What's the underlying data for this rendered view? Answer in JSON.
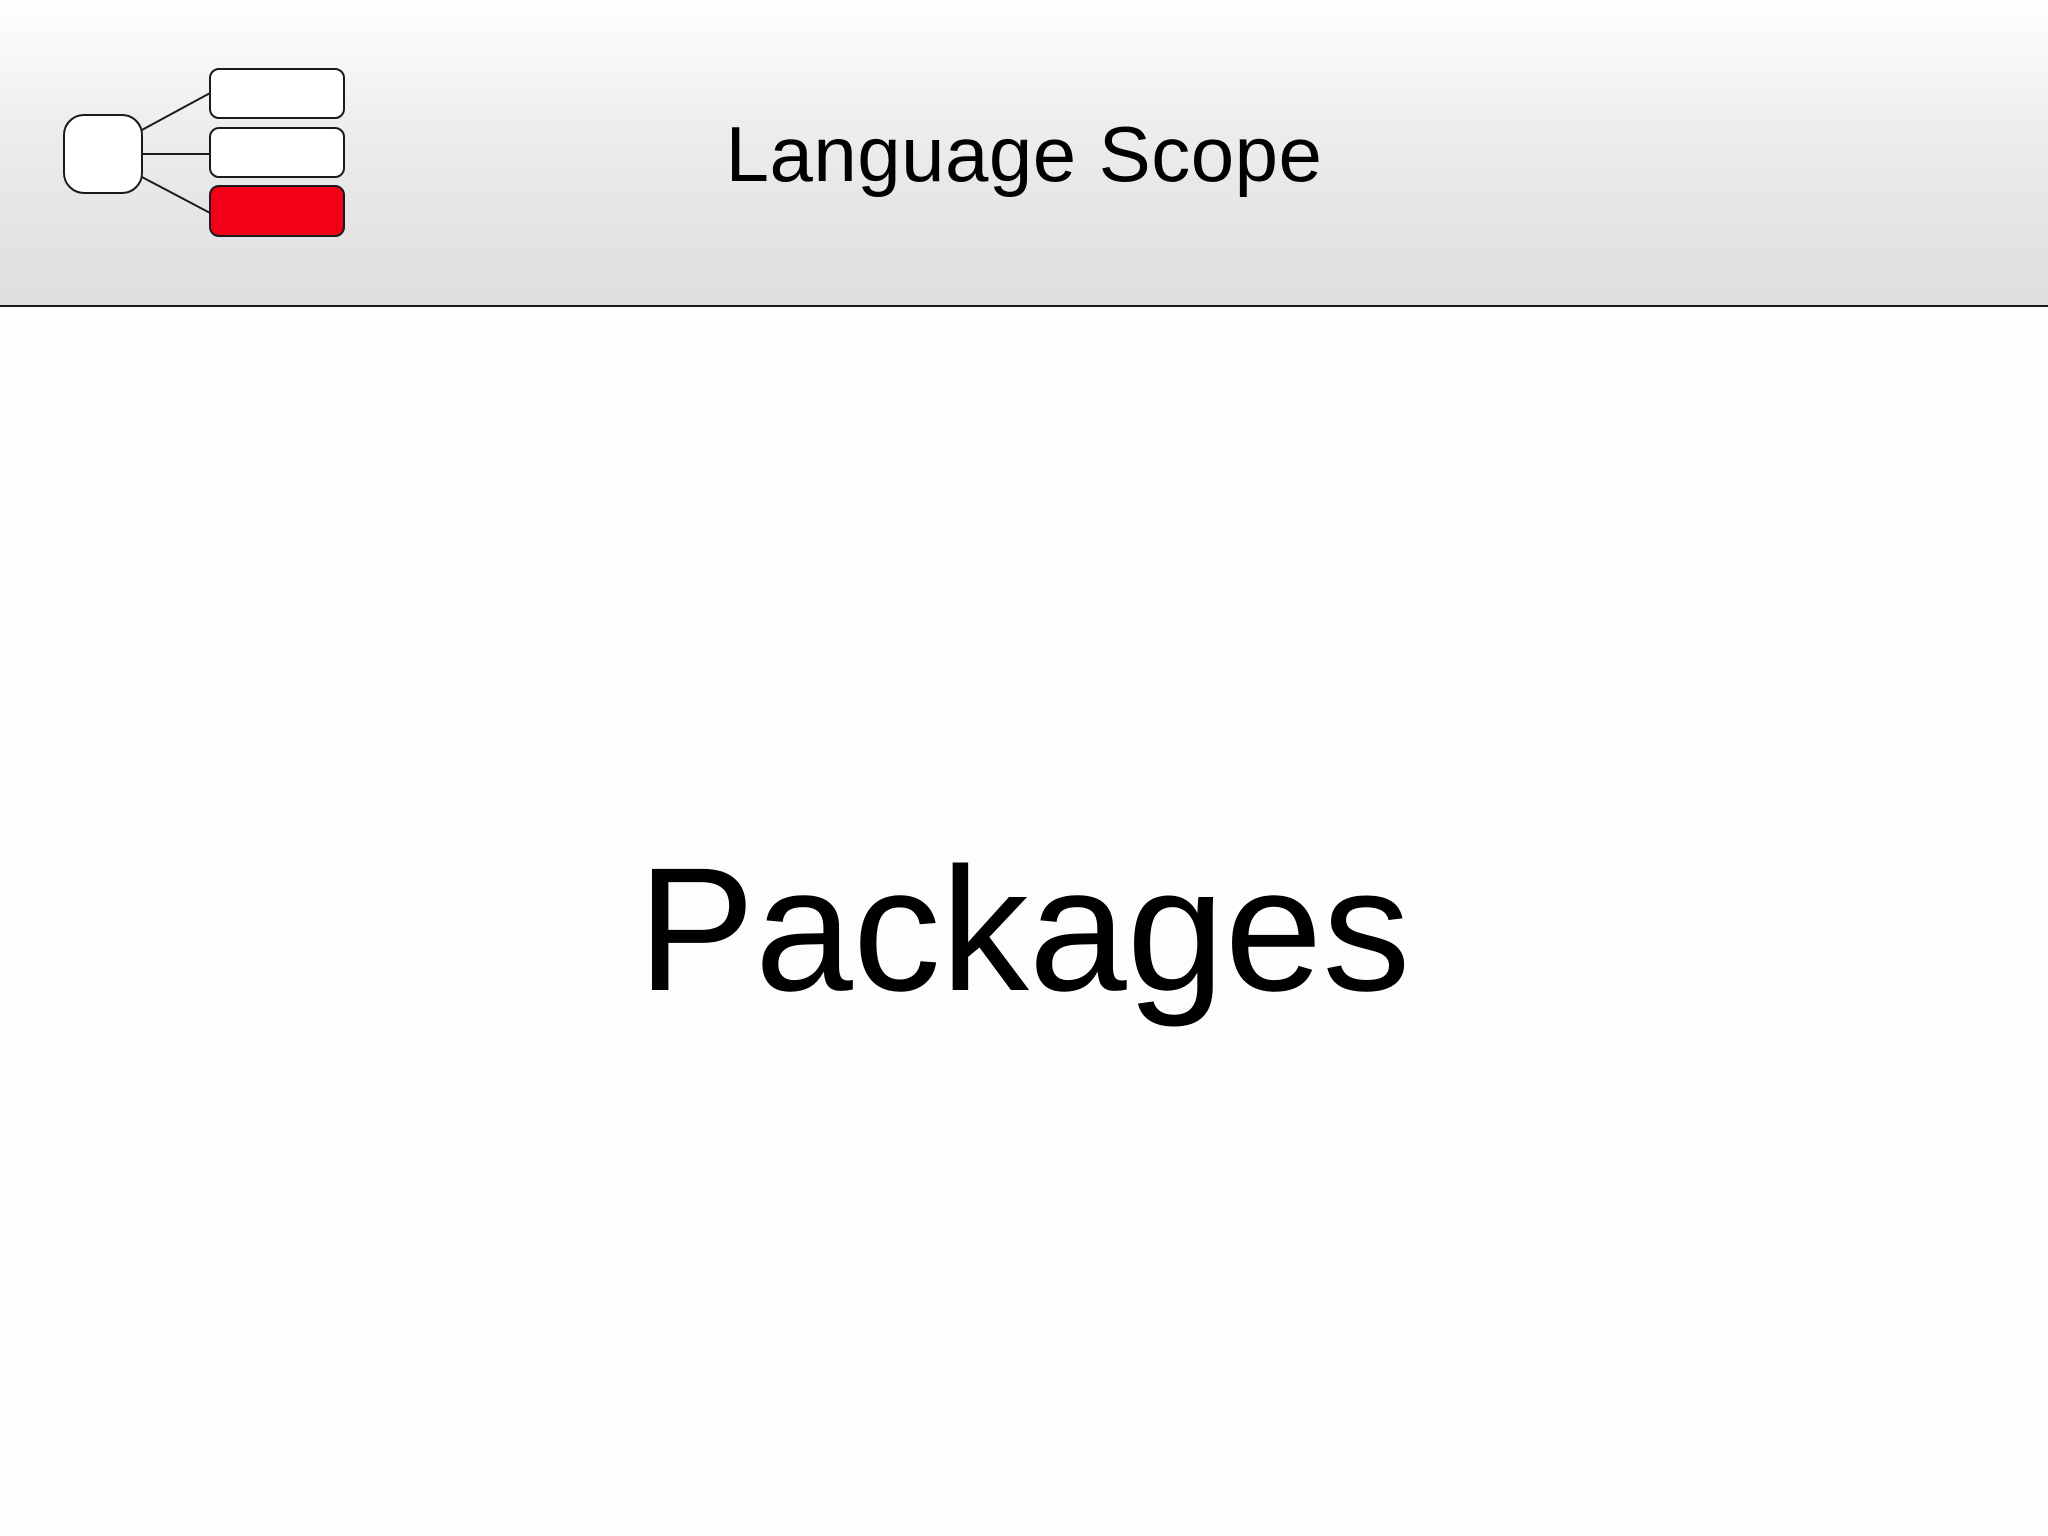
{
  "slide": {
    "header_title": "Language Scope",
    "section_title": "Packages"
  },
  "logo": {
    "icon": "tree-hierarchy-icon",
    "highlight_color": "#f20018",
    "box_color": "#ffffff",
    "stroke_color": "#1a1a1a"
  },
  "colors": {
    "background": "#fdfdfd",
    "header_gradient_top": "#ffffff",
    "header_gradient_bottom": "#dededf",
    "text": "#000000"
  }
}
